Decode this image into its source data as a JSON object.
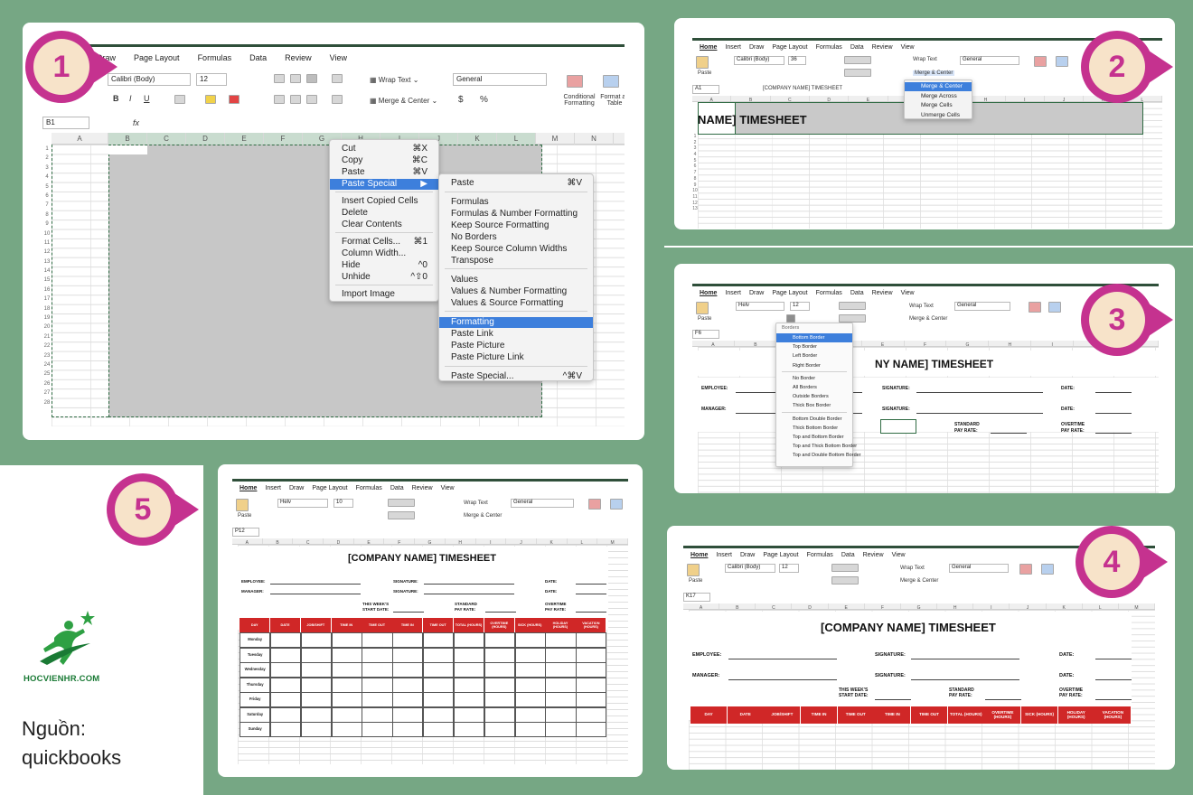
{
  "colors": {
    "frame_green": "#76a784",
    "pin_magenta": "#c5328f",
    "pin_cream": "#f7e3c9",
    "header_red": "#d02727",
    "selection_blue": "#3d7fdc"
  },
  "steps": [
    "1",
    "2",
    "3",
    "4",
    "5"
  ],
  "source": {
    "line1": "Nguồn:",
    "line2": "quickbooks"
  },
  "logo": {
    "text": "HOCVIENHR.COM",
    "icon": "runner-star-icon"
  },
  "ribbon": {
    "tabs": [
      "Home",
      "Insert",
      "Draw",
      "Page Layout",
      "Formulas",
      "Data",
      "Review",
      "View"
    ],
    "step1_tabs": [
      "Draw",
      "Page Layout",
      "Formulas",
      "Data",
      "Review",
      "View"
    ],
    "font_calibri": "Calibri (Body)",
    "font_helv": "Helv",
    "size_12": "12",
    "size_36": "36",
    "size_10": "10",
    "wrap_text": "Wrap Text",
    "merge_center": "Merge & Center",
    "number_format": "General",
    "conditional": "Conditional Formatting",
    "format_table": "Format as Table",
    "paste": "Paste",
    "bold": "B",
    "italic": "I",
    "underline": "U",
    "percent": "%",
    "dollar": "$",
    "fx": "fx"
  },
  "step1": {
    "name_box": "B1",
    "col_headers": [
      "A",
      "B",
      "C",
      "D",
      "E",
      "F",
      "G",
      "H",
      "I",
      "J",
      "K",
      "L",
      "M",
      "N"
    ],
    "rows": [
      "1",
      "2",
      "3",
      "4",
      "5",
      "6",
      "7",
      "8",
      "9",
      "10",
      "11",
      "12",
      "13",
      "14",
      "15",
      "16",
      "17",
      "18",
      "19",
      "20",
      "21",
      "22",
      "23",
      "24",
      "25",
      "26",
      "27",
      "28"
    ],
    "context_menu": [
      {
        "label": "Cut",
        "shortcut": "⌘X"
      },
      {
        "label": "Copy",
        "shortcut": "⌘C"
      },
      {
        "label": "Paste",
        "shortcut": "⌘V"
      },
      {
        "label": "Paste Special",
        "shortcut": "▶"
      },
      {
        "label": "Insert Copied Cells",
        "shortcut": ""
      },
      {
        "label": "Delete",
        "shortcut": ""
      },
      {
        "label": "Clear Contents",
        "shortcut": ""
      },
      {
        "label": "Format Cells...",
        "shortcut": "⌘1"
      },
      {
        "label": "Column Width...",
        "shortcut": ""
      },
      {
        "label": "Hide",
        "shortcut": "^0"
      },
      {
        "label": "Unhide",
        "shortcut": "^⇧0"
      },
      {
        "label": "Import Image",
        "shortcut": ""
      }
    ],
    "paste_submenu": [
      {
        "label": "Paste",
        "shortcut": "⌘V"
      },
      {
        "label": "Formulas",
        "shortcut": ""
      },
      {
        "label": "Formulas & Number Formatting",
        "shortcut": ""
      },
      {
        "label": "Keep Source Formatting",
        "shortcut": ""
      },
      {
        "label": "No Borders",
        "shortcut": ""
      },
      {
        "label": "Keep Source Column Widths",
        "shortcut": ""
      },
      {
        "label": "Transpose",
        "shortcut": ""
      },
      {
        "label": "Values",
        "shortcut": ""
      },
      {
        "label": "Values & Number Formatting",
        "shortcut": ""
      },
      {
        "label": "Values & Source Formatting",
        "shortcut": ""
      },
      {
        "label": "Formatting",
        "shortcut": ""
      },
      {
        "label": "Paste Link",
        "shortcut": ""
      },
      {
        "label": "Paste Picture",
        "shortcut": ""
      },
      {
        "label": "Paste Picture Link",
        "shortcut": ""
      },
      {
        "label": "Paste Special...",
        "shortcut": "^⌘V"
      }
    ]
  },
  "step2": {
    "name_box": "A1",
    "formula": "[COMPANY NAME] TIMESHEET",
    "cell_text": "NAME] TIMESHEET",
    "merge_menu": [
      "Merge & Center",
      "Merge Across",
      "Merge Cells",
      "Unmerge Cells"
    ],
    "rows": [
      "1",
      "2",
      "3",
      "4",
      "5",
      "6",
      "7",
      "8",
      "9",
      "10",
      "11",
      "12",
      "13"
    ]
  },
  "step3": {
    "name_box": "F6",
    "title": "NY NAME] TIMESHEET",
    "borders_heading": "Borders",
    "borders_menu": [
      "Bottom Border",
      "Top Border",
      "Left Border",
      "Right Border",
      "No Border",
      "All Borders",
      "Outside Borders",
      "Thick Box Border",
      "Bottom Double Border",
      "Thick Bottom Border",
      "Top and Bottom Border",
      "Top and Thick Bottom Border",
      "Top and Double Bottom Border"
    ],
    "labels": {
      "employee": "EMPLOYEE:",
      "manager": "MANAGER:",
      "signature": "SIGNATURE:",
      "date": "DATE:",
      "standard": "STANDARD",
      "pay_rate": "PAY RATE:",
      "overtime": "OVERTIME",
      "ot_pay_rate": "PAY RATE:"
    }
  },
  "step4": {
    "name_box": "K17",
    "title": "[COMPANY NAME] TIMESHEET",
    "labels": {
      "employee": "EMPLOYEE:",
      "manager": "MANAGER:",
      "signature": "SIGNATURE:",
      "date": "DATE:",
      "week": "THIS WEEK'S",
      "start": "START DATE:",
      "standard": "STANDARD",
      "pay_rate": "PAY RATE:",
      "overtime": "OVERTIME",
      "ot_pay_rate": "PAY RATE:"
    },
    "headers": [
      "DAY",
      "DATE",
      "JOB/SHIFT",
      "TIME IN",
      "TIME OUT",
      "TIME IN",
      "TIME OUT",
      "TOTAL (HOURS)",
      "OVERTIME (HOURS)",
      "SICK (HOURS)",
      "HOLIDAY (HOURS)",
      "VACATION (HOURS)"
    ]
  },
  "step5": {
    "name_box": "P12",
    "title": "[COMPANY NAME] TIMESHEET",
    "labels": {
      "employee": "EMPLOYEE:",
      "manager": "MANAGER:",
      "signature": "SIGNATURE:",
      "date": "DATE:",
      "week": "THIS WEEK'S",
      "start": "START DATE:",
      "standard": "STANDARD",
      "pay_rate": "PAY RATE:",
      "overtime": "OVERTIME",
      "ot_pay_rate": "PAY RATE:"
    },
    "headers": [
      "DAY",
      "DATE",
      "JOB/SHIFT",
      "TIME IN",
      "TIME OUT",
      "TIME IN",
      "TIME OUT",
      "TOTAL (HOURS)",
      "OVERTIME (HOURS)",
      "SICK (HOURS)",
      "HOLIDAY (HOURS)",
      "VACATION (HOURS)"
    ],
    "days": [
      "Monday",
      "Tuesday",
      "Wednesday",
      "Thursday",
      "Friday",
      "Saturday",
      "Sunday"
    ]
  }
}
